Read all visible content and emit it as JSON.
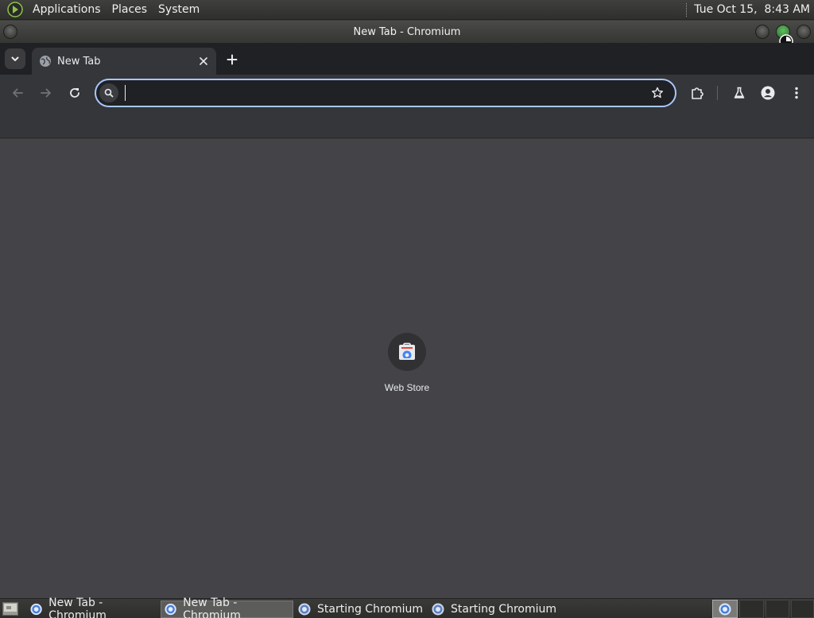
{
  "top_panel": {
    "menus": [
      "Applications",
      "Places",
      "System"
    ],
    "clock": "Tue Oct 15,  8:43 AM"
  },
  "window": {
    "title": "New Tab - Chromium"
  },
  "browser": {
    "tabs": [
      {
        "title": "New Tab",
        "active": true
      }
    ],
    "omnibox": {
      "value": "",
      "placeholder": ""
    },
    "shortcuts": [
      {
        "label": "Web Store"
      }
    ]
  },
  "taskbar": {
    "tasks": [
      {
        "label": "New Tab - Chromium",
        "active": false
      },
      {
        "label": "New Tab - Chromium",
        "active": true
      },
      {
        "label": "Starting Chromium",
        "active": false
      },
      {
        "label": "Starting Chromium",
        "active": false
      }
    ]
  },
  "icons": {
    "tab_search": "chevron-down-icon",
    "favicon": "globe-icon",
    "close": "close-icon",
    "new_tab": "plus-icon",
    "back": "arrow-left-icon",
    "forward": "arrow-right-icon",
    "reload": "reload-icon",
    "search": "search-icon",
    "bookmark": "star-icon",
    "extensions": "puzzle-icon",
    "labs": "flask-icon",
    "profile": "person-icon",
    "menu": "kebab-menu-icon",
    "web_store": "web-store-icon"
  },
  "colors": {
    "content_bg": "#444448",
    "toolbar_bg": "#35363a",
    "tabstrip_bg": "#202124",
    "focus_ring": "#a8c7fa"
  }
}
